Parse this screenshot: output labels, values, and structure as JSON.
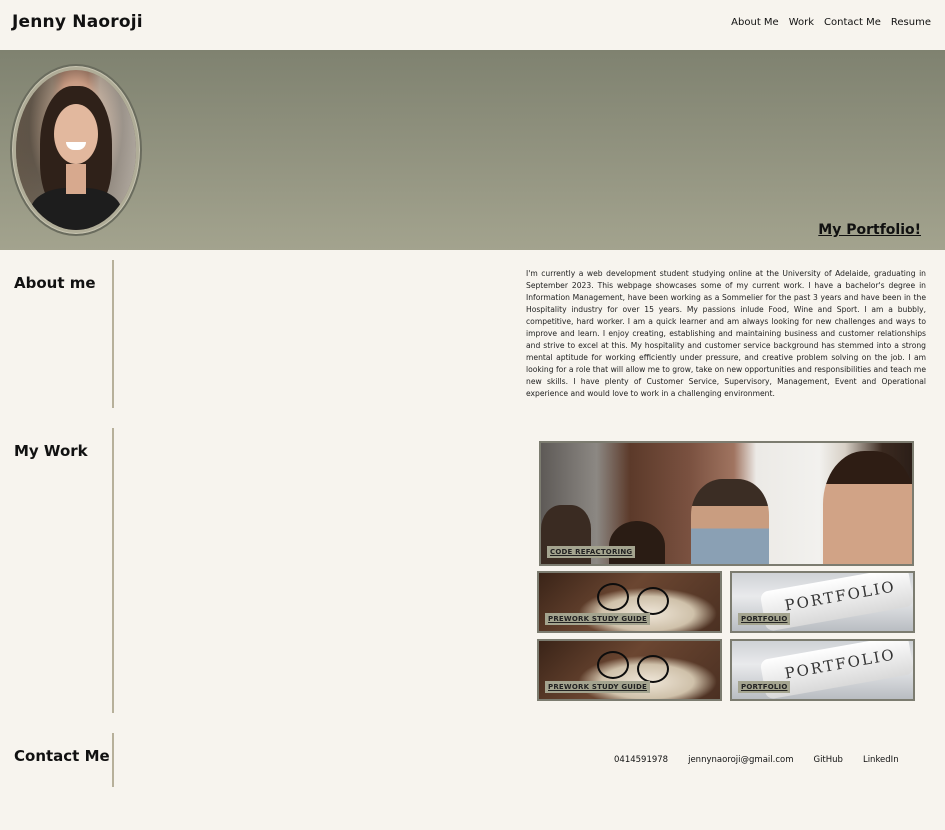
{
  "header": {
    "brand": "Jenny Naoroji",
    "nav": [
      "About Me",
      "Work",
      "Contact Me",
      "Resume"
    ]
  },
  "hero": {
    "title": "My Portfolio!"
  },
  "about": {
    "heading": "About me",
    "text": "I'm currently a web development student studying online at the University of Adelaide, graduating in September 2023. This webpage showcases some of my current work. I have a bachelor's degree in Information Management, have been working as a Sommelier for the past 3 years and have been in the Hospitality industry for over 15 years. My passions inlude Food, Wine and Sport. I am a bubbly, competitive, hard worker. I am a quick learner and am always looking for new challenges and ways to improve and learn. I enjoy creating, establishing and maintaining business and customer relationships and strive to excel at this. My hospitality and customer service background has stemmed into a strong mental aptitude for working efficiently under pressure, and creative problem solving on the job. I am looking for a role that will allow me to grow, take on new opportunities and responsibilities and teach me new skills. I have plenty of Customer Service, Supervisory, Management, Event and Operational experience and would love to work in a challenging environment."
  },
  "work": {
    "heading": "My Work",
    "projects": [
      {
        "label": "CODE REFACTORING"
      },
      {
        "label": "PREWORK STUDY GUIDE"
      },
      {
        "label": "PORTFOLIO"
      },
      {
        "label": "PREWORK STUDY GUIDE"
      },
      {
        "label": "PORTFOLIO"
      }
    ],
    "paper_word": "PORTFOLIO"
  },
  "contact": {
    "heading": "Contact Me",
    "phone": "0414591978",
    "email": "jennynaoroji@gmail.com",
    "github": "GitHub",
    "linkedin": "LinkedIn"
  },
  "colors": {
    "background": "#f7f4ee",
    "accent": "#a4a48f",
    "divider": "#b7b09a"
  }
}
